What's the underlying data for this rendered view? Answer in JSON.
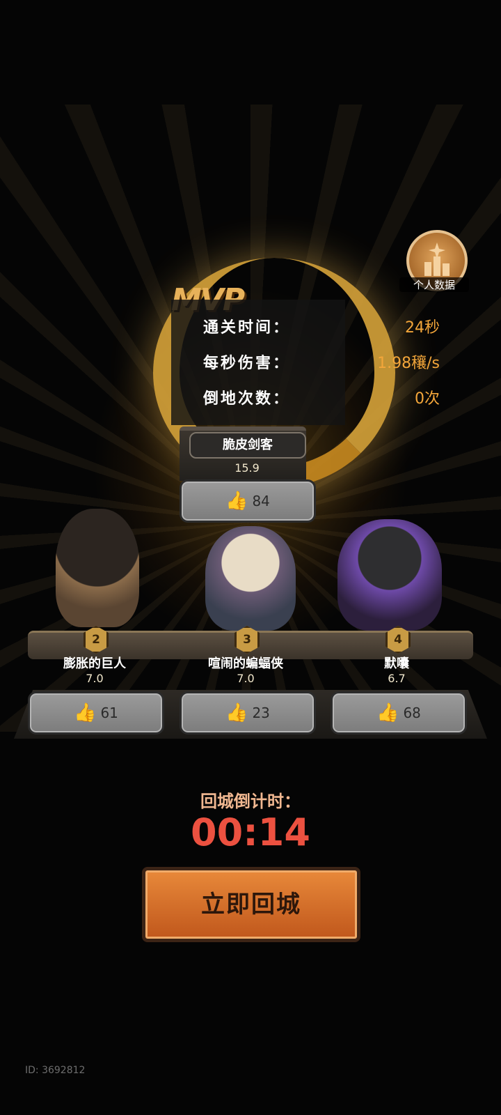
{
  "personal_data": {
    "label": "个人数据"
  },
  "mvp": {
    "stats": [
      {
        "label": "通关时间：",
        "value": "24秒"
      },
      {
        "label": "每秒伤害：",
        "value": "1.98穰/s"
      },
      {
        "label": "倒地次数：",
        "value": "0次"
      }
    ],
    "name": "脆皮剑客",
    "score": "15.9",
    "likes": "84"
  },
  "heroes": [
    {
      "rank": "2",
      "name": "膨胀的巨人",
      "score": "7.0",
      "likes": "61"
    },
    {
      "rank": "3",
      "name": "喧闹的蝙蝠侠",
      "score": "7.0",
      "likes": "23"
    },
    {
      "rank": "4",
      "name": "默囔",
      "score": "6.7",
      "likes": "68"
    }
  ],
  "countdown": {
    "label": "回城倒计时：",
    "value": "00:14"
  },
  "return_button": {
    "label": "立即回城"
  },
  "uid": "ID: 3692812",
  "colors": {
    "accent_orange": "#f3a63a",
    "countdown_red": "#ec5140",
    "button_orange": "#d8732d"
  }
}
